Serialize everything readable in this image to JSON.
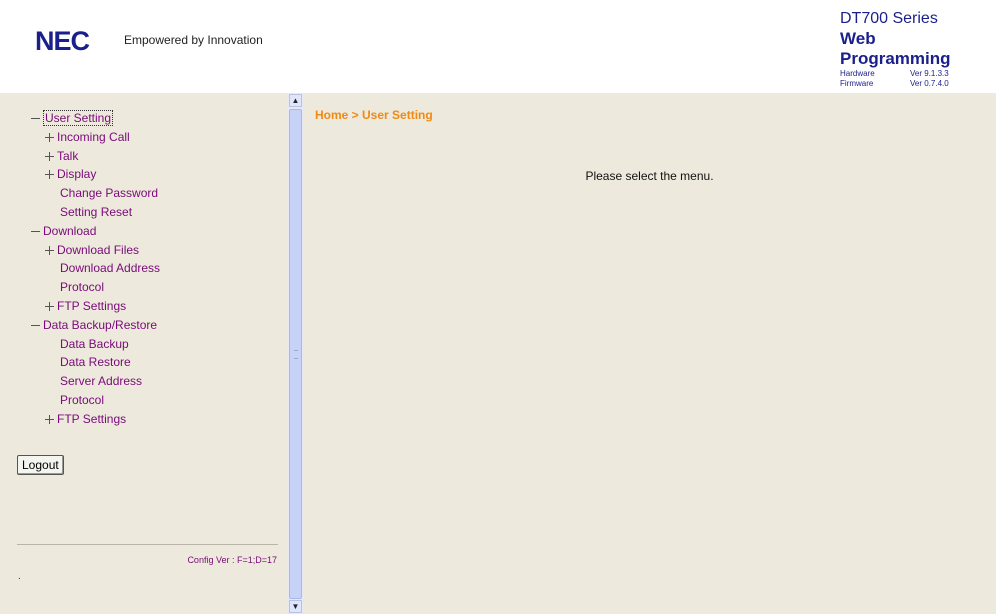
{
  "header": {
    "logo": "NEC",
    "tagline": "Empowered by Innovation",
    "series": "DT700 Series",
    "web_programming": "Web Programming",
    "hardware_label": "Hardware",
    "hardware_ver": "Ver 9.1.3.3",
    "firmware_label": "Firmware",
    "firmware_ver": "Ver 0.7.4.0"
  },
  "menu": {
    "user_setting": "User Setting",
    "incoming_call": "Incoming Call",
    "talk": "Talk",
    "display": "Display",
    "change_password": "Change Password",
    "setting_reset": "Setting Reset",
    "download": "Download",
    "download_files": "Download Files",
    "download_address": "Download Address",
    "protocol_dl": "Protocol",
    "ftp_settings_dl": "FTP Settings",
    "data_backup_restore": "Data Backup/Restore",
    "data_backup": "Data Backup",
    "data_restore": "Data Restore",
    "server_address": "Server Address",
    "protocol_br": "Protocol",
    "ftp_settings_br": "FTP Settings"
  },
  "sidebar": {
    "logout_label": "Logout",
    "config_ver": "Config Ver : F=1;D=17",
    "dot": "."
  },
  "content": {
    "breadcrumb": "Home > User Setting",
    "message": "Please select the menu."
  },
  "colors": {
    "panel_bg": "#ede9dc",
    "link": "#7a0a7a",
    "breadcrumb": "#f08a10",
    "brand": "#1a1f8c"
  }
}
